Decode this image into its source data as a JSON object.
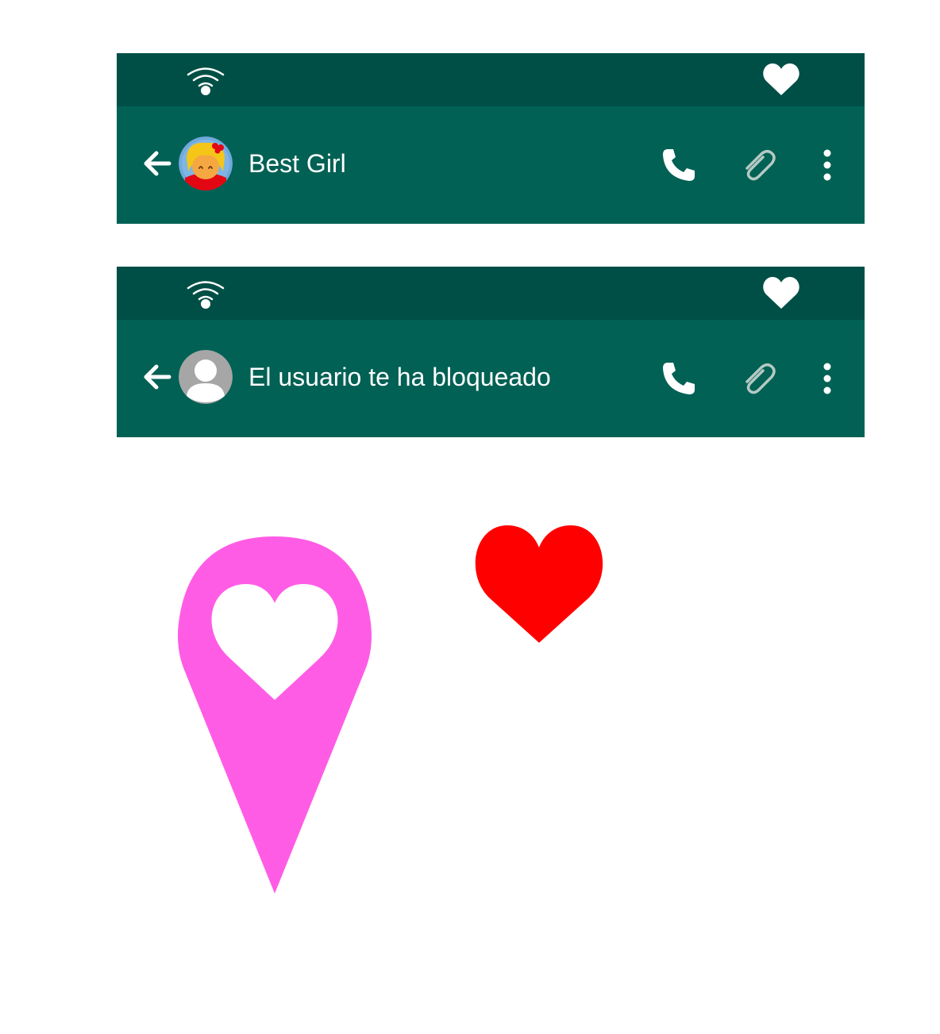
{
  "headers": [
    {
      "title": "Best Girl",
      "avatar": "girl-avatar",
      "icons": {
        "status_left": "wifi-icon",
        "status_right": "heart-icon",
        "back": "arrow-left-icon",
        "call": "phone-icon",
        "attach": "paperclip-icon",
        "menu": "more-vertical-icon"
      }
    },
    {
      "title": "El usuario te ha bloqueado",
      "avatar": "default-user-avatar",
      "icons": {
        "status_left": "wifi-icon",
        "status_right": "heart-icon",
        "back": "arrow-left-icon",
        "call": "phone-icon",
        "attach": "paperclip-icon",
        "menu": "more-vertical-icon"
      }
    }
  ],
  "graphics": {
    "pin": "heart-location-pin-icon",
    "heart": "red-heart-icon"
  },
  "colors": {
    "status_bar": "#004f46",
    "toolbar": "#006154",
    "pin": "#ff5ce6",
    "heart": "#ff0000",
    "attach_icon": "#b5c9c4",
    "default_avatar": "#a6a6a6"
  }
}
